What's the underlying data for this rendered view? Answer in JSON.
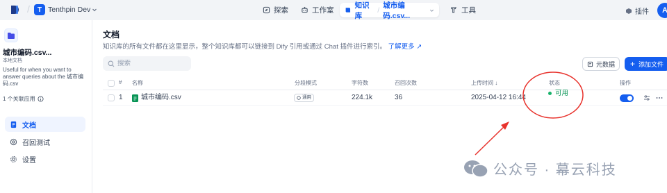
{
  "topbar": {
    "workspace_initial": "T",
    "workspace_name": "Tenthpin Dev",
    "nav": [
      {
        "label": "探索",
        "icon": "compass-icon"
      },
      {
        "label": "工作室",
        "icon": "robot-icon"
      },
      {
        "label": "知识库",
        "sub": "城市编码.csv...",
        "icon": "book-icon"
      },
      {
        "label": "工具",
        "icon": "hammer-icon"
      }
    ],
    "plugins_label": "插件",
    "user_initial": "A"
  },
  "sidebar": {
    "dataset_name": "城市编码.csv...",
    "dataset_type": "本地文档",
    "description": "Useful for when you want to answer queries about the 城市编码.csv",
    "linked_apps": "1 个关联应用",
    "menu": [
      {
        "label": "文档",
        "icon": "document-icon",
        "active": true
      },
      {
        "label": "召回测试",
        "icon": "target-icon",
        "active": false
      },
      {
        "label": "设置",
        "icon": "gear-icon",
        "active": false
      }
    ]
  },
  "main": {
    "title": "文档",
    "description": "知识库的所有文件都在这里显示，整个知识库都可以链接到 Dify 引用或通过 Chat 插件进行索引。",
    "learn_more": "了解更多",
    "search_placeholder": "搜索",
    "metadata_button": "元数据",
    "add_file_button": "添加文件",
    "table": {
      "headers": {
        "index": "#",
        "name": "名称",
        "chunk_mode": "分段模式",
        "chars": "字符数",
        "recall": "召回次数",
        "upload_time": "上传时间 ↓",
        "status": "状态",
        "actions": "操作"
      },
      "rows": [
        {
          "index": "1",
          "name": "城市编码.csv",
          "chunk_mode": "通用",
          "chars": "224.1k",
          "recall": "36",
          "upload_time": "2025-04-12 16:44",
          "status": "可用",
          "enabled": true
        }
      ]
    }
  },
  "watermark": "公众号 · 幕云科技",
  "colors": {
    "accent": "#155eef",
    "status_ok": "#17b26a",
    "annotation": "#e8322c"
  }
}
